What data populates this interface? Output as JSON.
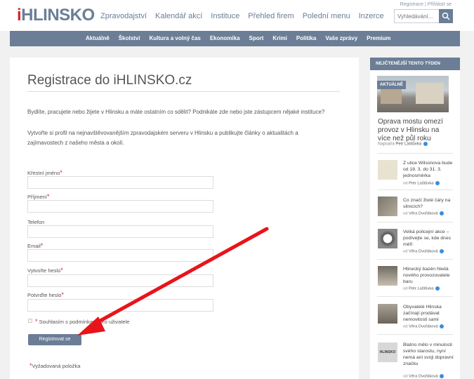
{
  "header": {
    "logo_i": "i",
    "logo_rest": "HLINSKO",
    "nav": [
      "Zpravodajství",
      "Kalendář akcí",
      "Instituce",
      "Přehled firem",
      "Polední menu",
      "Inzerce"
    ],
    "top_links": "Registrace  |  Přihlásit se",
    "search_placeholder": "Vyhledávání..."
  },
  "subnav": [
    "Aktuálně",
    "Školství",
    "Kultura a volný čas",
    "Ekonomika",
    "Sport",
    "Krimi",
    "Politika",
    "Vaše zprávy",
    "Premium"
  ],
  "page": {
    "title": "Registrace do iHLINSKO.cz",
    "intro1": "Bydlíte, pracujete nebo žijete v Hlinsku a máte ostatním co sdělit? Podnikáte zde nebo jste zástupcem nějaké instituce?",
    "intro2": "Vytvořte si profil na nejnavštěvovanějším zpravodajském serveru v Hlinsku a publikujte články o aktualitách a zajímavostech z našeho města a okolí."
  },
  "form": {
    "fields": [
      {
        "label": "Křestní jméno",
        "required": true,
        "value": ""
      },
      {
        "label": "Příjmení",
        "required": true,
        "value": ""
      },
      {
        "label": "Telefon",
        "required": false,
        "value": ""
      },
      {
        "label": "Email",
        "required": true,
        "value": ""
      },
      {
        "label": "Vytvořte heslo",
        "required": true,
        "value": ""
      },
      {
        "label": "Potvrďte heslo",
        "required": true,
        "value": ""
      }
    ],
    "required_mark": "*",
    "consent_label": "Souhlasím s podmínkami pro uživatele",
    "submit_label": "Registrovat se",
    "required_note": "Vyžadovaná položka"
  },
  "sidebar": {
    "heading": "NEJČTENĚJŠÍ TENTO TÝDEN",
    "featured": {
      "badge": "AKTUÁLNĚ",
      "title": "Oprava mostu omezí provoz v Hlinsku na více než půl roku",
      "author_prefix": "Napsal/a",
      "author": "Petr Laštůvka"
    },
    "author_prefix": "od",
    "items": [
      {
        "title": "Z ulice Wilsonova bude od 18. 3. do 31. 3. jednosměrka",
        "author": "Petr Laštůvka"
      },
      {
        "title": "Co značí žluté čáry na silnicích?",
        "author": "Věra Dvořáková"
      },
      {
        "title": "Velká policejní akce – podívejte se, kde dnes měří",
        "author": "Věra Dvořáková"
      },
      {
        "title": "Hlinecký bazén hledá nového provozovatele baru",
        "author": "Petr Laštůvka"
      },
      {
        "title": "Obyvatelé Hlinska začínají prodávat nemovitosti sami",
        "author": "Věra Dvořáková"
      },
      {
        "title": "Blatno mělo v minulosti svého starostu, nyní nemá ani svoji dopravní značku",
        "author": "Věra Dvořáková"
      }
    ],
    "sign_text": "HLINSKO"
  },
  "colors": {
    "accent": "#6b7e96",
    "required": "#d8262c",
    "arrow": "#e8141a"
  }
}
